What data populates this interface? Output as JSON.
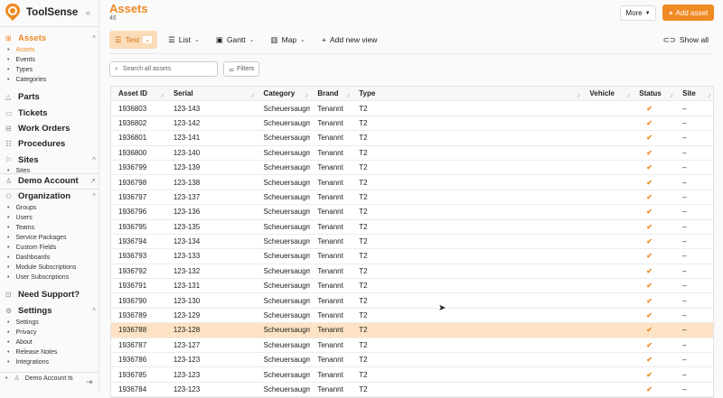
{
  "app": {
    "name": "ToolSense",
    "collapse_icon": "double-chevron-left"
  },
  "sidebar": {
    "assets": {
      "label": "Assets",
      "items": [
        "Assets",
        "Events",
        "Types",
        "Categories"
      ]
    },
    "parts": "Parts",
    "tickets": "Tickets",
    "work_orders": "Work Orders",
    "procedures": "Procedures",
    "sites": {
      "label": "Sites",
      "items": [
        "Sites"
      ]
    },
    "demo_account": "Demo Account",
    "organization": {
      "label": "Organization",
      "items": [
        "Groups",
        "Users",
        "Teams",
        "Service Packages",
        "Custom Fields",
        "Dashboards",
        "Module Subscriptions",
        "User Subscriptions"
      ]
    },
    "support": "Need Support?",
    "settings": {
      "label": "Settings",
      "items": [
        "Settings",
        "Privacy",
        "About",
        "Release Notes",
        "Integrations"
      ]
    },
    "user": "Demo Account ts"
  },
  "header": {
    "title": "Assets",
    "count": "46",
    "more": "More",
    "add": "Add asset"
  },
  "views": {
    "items": [
      "Test",
      "List",
      "Gantt",
      "Map"
    ],
    "add": "Add new view",
    "show_all": "Show all"
  },
  "search": {
    "placeholder": "Search all assets"
  },
  "filters": "Filters",
  "table": {
    "columns": [
      "Asset ID",
      "Serial",
      "Category",
      "Brand",
      "Type",
      "Vehicle",
      "Status",
      "Site"
    ],
    "selected_index": 15,
    "rows": [
      [
        "1936803",
        "123-143"
      ],
      [
        "1936802",
        "123-142"
      ],
      [
        "1936801",
        "123-141"
      ],
      [
        "1936800",
        "123-140"
      ],
      [
        "1936799",
        "123-139"
      ],
      [
        "1936798",
        "123-138"
      ],
      [
        "1936797",
        "123-137"
      ],
      [
        "1936796",
        "123-136"
      ],
      [
        "1936795",
        "123-135"
      ],
      [
        "1936794",
        "123-134"
      ],
      [
        "1936793",
        "123-133"
      ],
      [
        "1936792",
        "123-132"
      ],
      [
        "1936791",
        "123-131"
      ],
      [
        "1936790",
        "123-130"
      ],
      [
        "1936789",
        "123-129"
      ],
      [
        "1936788",
        "123-128"
      ],
      [
        "1936787",
        "123-127"
      ],
      [
        "1936786",
        "123-123"
      ],
      [
        "1936785",
        "123-123"
      ],
      [
        "1936784",
        "123-123"
      ]
    ],
    "category": "Scheuersaugm",
    "brand": "Tenannt",
    "type": "T2",
    "vehicle": "",
    "status": "✔",
    "site": "–"
  },
  "colors": {
    "accent": "#f08a24",
    "selected_row": "#fde3c4"
  }
}
